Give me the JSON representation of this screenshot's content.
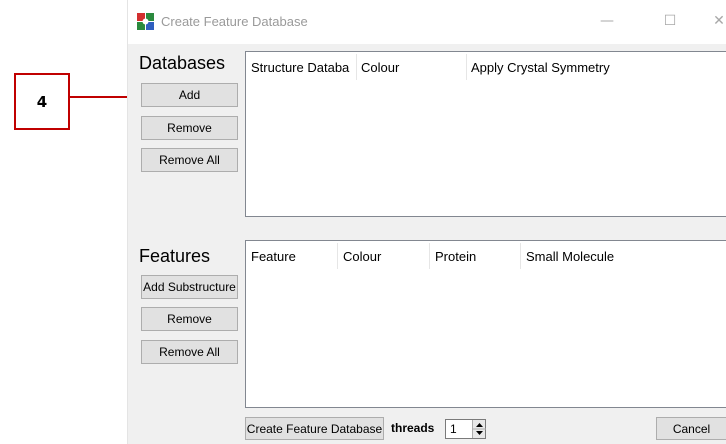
{
  "callout": {
    "number": "4"
  },
  "window": {
    "title": "Create Feature Database",
    "controls": {
      "minimize": "—",
      "maximize": "☐",
      "close": "✕"
    }
  },
  "databases": {
    "label": "Databases",
    "buttons": {
      "add": "Add",
      "remove": "Remove",
      "remove_all": "Remove All"
    },
    "columns": [
      "Structure Databa",
      "Colour",
      "Apply Crystal Symmetry"
    ]
  },
  "features": {
    "label": "Features",
    "buttons": {
      "add_substructure": "Add Substructure",
      "remove": "Remove",
      "remove_all": "Remove All"
    },
    "columns": [
      "Feature",
      "Colour",
      "Protein",
      "Small Molecule"
    ]
  },
  "footer": {
    "create_button": "Create Feature Database",
    "threads_label": "threads",
    "threads_value": "1",
    "cancel_button": "Cancel"
  },
  "colors": {
    "callout": "#c00000",
    "window_bg": "#f0f0f0",
    "button_bg": "#e1e1e1"
  }
}
